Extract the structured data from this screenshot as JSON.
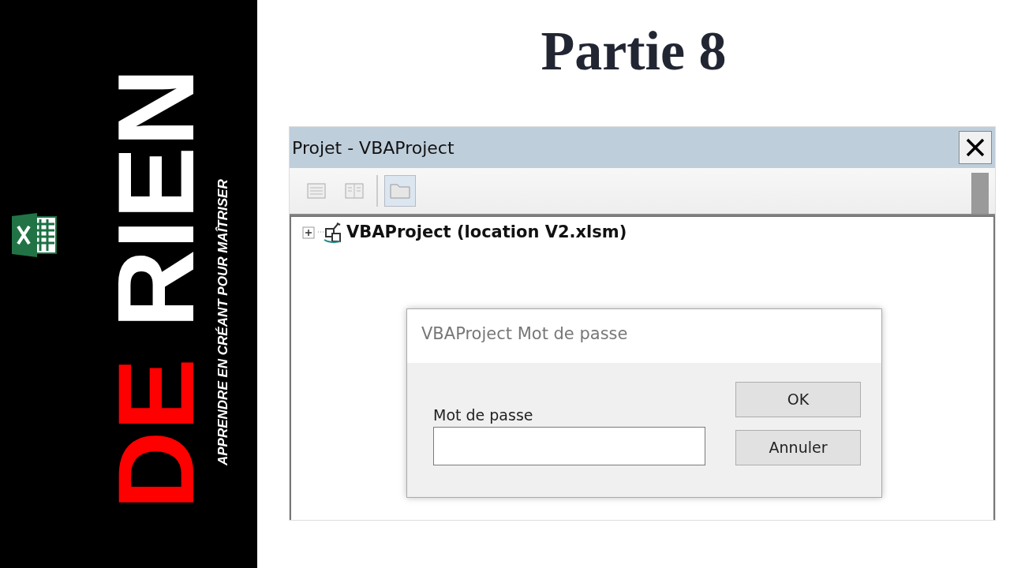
{
  "banner": {
    "title_first": "DE",
    "title_second": "RIEN",
    "tagline": "APPRENDRE EN CRÉANT POUR MAÎTRISER"
  },
  "heading": "Partie 8",
  "window": {
    "title": "Projet - VBAProject",
    "toolbar": [
      {
        "kind": "code",
        "selected": false
      },
      {
        "kind": "object",
        "selected": false
      },
      {
        "kind": "folder",
        "selected": true
      }
    ],
    "tree": [
      {
        "label": "VBAProject (location V2.xlsm)",
        "expanded": false
      }
    ]
  },
  "dialog": {
    "title": "VBAProject Mot de passe",
    "field_label": "Mot de passe",
    "buttons": [
      "OK",
      "Annuler"
    ]
  }
}
